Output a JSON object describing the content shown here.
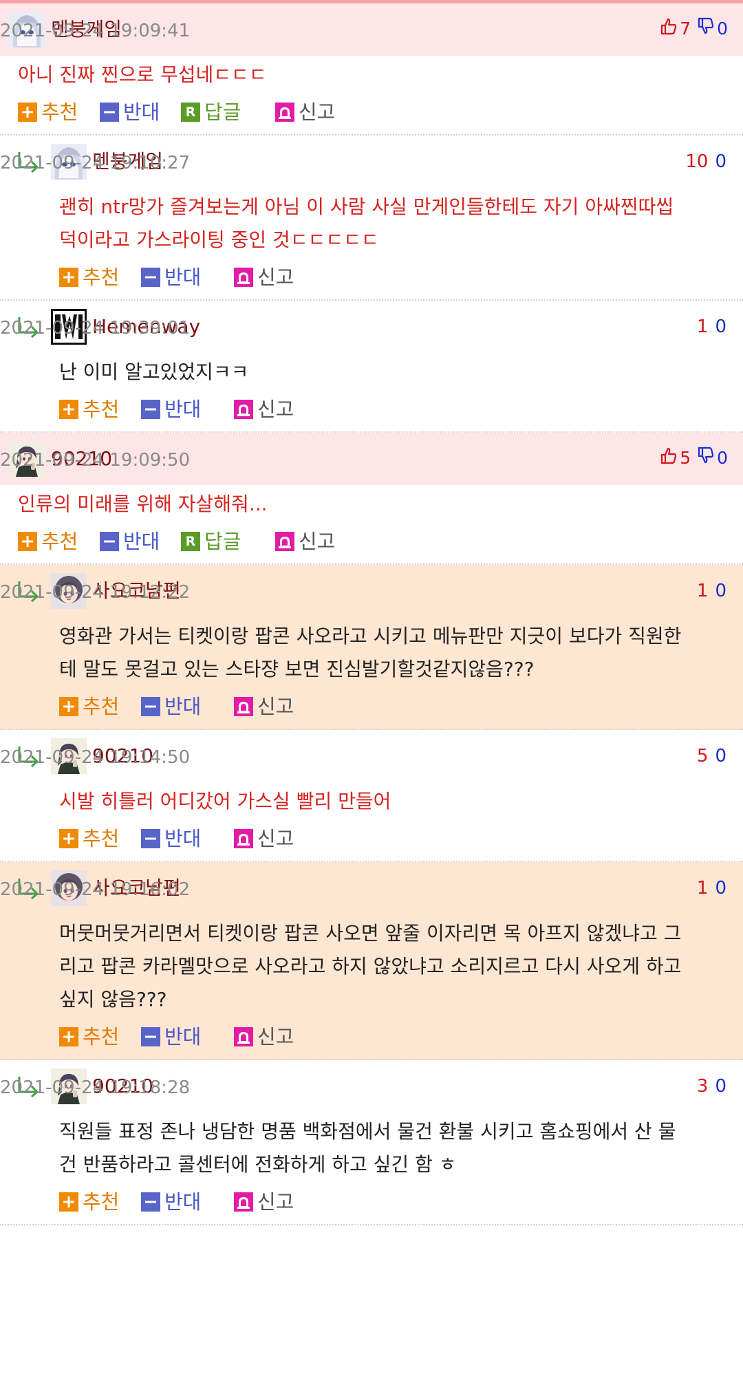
{
  "labels": {
    "recommend": "추천",
    "oppose": "반대",
    "reply": "답글",
    "report": "신고",
    "reply_icon_letter": "R"
  },
  "colors": {
    "top_header_bg": "#fde5e8",
    "highlight_reply_bg": "#fde6d2",
    "nick": "#7b0e0e",
    "red_text": "#d6231f",
    "accent_up": "#d0171e",
    "accent_down": "#1a2fd0"
  },
  "comments": [
    {
      "type": "top",
      "nick": "멘붕게임",
      "time": "2021-09-24 19:09:41",
      "up": "7",
      "down": "0",
      "avatar": "ghost-avatar",
      "lines": [
        "아니 진짜 찐으로 무섭네ㄷㄷㄷ"
      ],
      "red": true
    },
    {
      "type": "reply",
      "nick": "멘붕게임",
      "time": "2021-09-24 19:10:27",
      "up": "10",
      "down": "0",
      "avatar": "ghost-avatar",
      "lines": [
        "괜히 ntr망가 즐겨보는게 아님 이 사람 사실 만게인들한테도 자기 아싸찐따씹",
        "덕이라고 가스라이팅 중인 것ㄷㄷㄷㄷㄷ"
      ],
      "red": true,
      "highlight": false
    },
    {
      "type": "reply",
      "nick": "Hemenway",
      "time": "2021-09-24 19:39:01",
      "up": "1",
      "down": "0",
      "avatar": "iw-logo-avatar",
      "lines": [
        "난 이미 알고있었지ㅋㅋ"
      ],
      "red": false,
      "highlight": false
    },
    {
      "type": "top",
      "nick": "90210",
      "time": "2021-09-24 19:09:50",
      "up": "5",
      "down": "0",
      "avatar": "anime-girl-avatar",
      "lines": [
        "인류의 미래를 위해 자살해줘..."
      ],
      "red": true
    },
    {
      "type": "reply",
      "nick": "사요코남편",
      "time": "2021-09-24 19:12:22",
      "up": "1",
      "down": "0",
      "avatar": "sayoko-avatar",
      "lines": [
        "영화관 가서는 티켓이랑 팝콘 사오라고 시키고 메뉴판만 지긋이 보다가 직원한",
        "테 말도 못걸고 있는 스타쟝 보면 진심발기할것같지않음???"
      ],
      "red": false,
      "highlight": true
    },
    {
      "type": "reply",
      "nick": "90210",
      "time": "2021-09-24 19:14:50",
      "up": "5",
      "down": "0",
      "avatar": "anime-girl-avatar",
      "lines": [
        "시발 히틀러 어디갔어 가스실 빨리 만들어"
      ],
      "red": true,
      "highlight": false
    },
    {
      "type": "reply",
      "nick": "사요코남편",
      "time": "2021-09-24 19:16:02",
      "up": "1",
      "down": "0",
      "avatar": "sayoko-avatar",
      "lines": [
        "머뭇머뭇거리면서 티켓이랑 팝콘 사오면 앞줄 이자리면 목 아프지 않겠냐고 그",
        "리고 팝콘 카라멜맛으로 사오라고 하지 않았냐고 소리지르고 다시 사오게 하고",
        "싶지 않음???"
      ],
      "red": false,
      "highlight": true
    },
    {
      "type": "reply",
      "nick": "90210",
      "time": "2021-09-24 19:18:28",
      "up": "3",
      "down": "0",
      "avatar": "anime-girl-avatar",
      "lines": [
        "직원들 표정 존나 냉담한 명품 백화점에서 물건 환불 시키고 홈쇼핑에서 산 물",
        "건 반품하라고 콜센터에 전화하게 하고 싶긴 함 ㅎ"
      ],
      "red": false,
      "highlight": false
    }
  ]
}
